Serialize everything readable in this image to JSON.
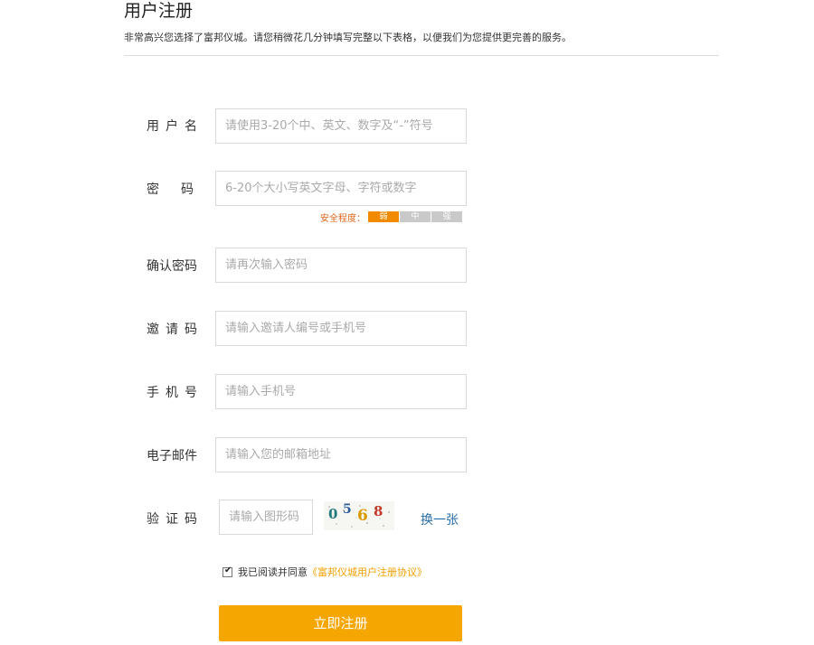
{
  "header": {
    "title": "用户注册",
    "intro": "非常高兴您选择了富邦仪城。请您稍微花几分钟填写完整以下表格，以便我们为您提供更完善的服务。"
  },
  "form": {
    "username": {
      "label": [
        "用",
        "户",
        "名"
      ],
      "placeholder": "请使用3-20个中、英文、数字及“-”符号"
    },
    "password": {
      "label": [
        "密",
        "码"
      ],
      "placeholder": "6-20个大小写英文字母、字符或数字"
    },
    "strength": {
      "label": "安全程度：",
      "levels": [
        "弱",
        "中",
        "强"
      ],
      "active": "弱"
    },
    "confirm": {
      "label": "确认密码",
      "placeholder": "请再次输入密码"
    },
    "invite": {
      "label": [
        "邀",
        "请",
        "码"
      ],
      "placeholder": "请输入邀请人编号或手机号"
    },
    "phone": {
      "label": [
        "手",
        "机",
        "号"
      ],
      "placeholder": "请输入手机号"
    },
    "email": {
      "label": "电子邮件",
      "placeholder": "请输入您的邮箱地址"
    },
    "captcha": {
      "label": [
        "验",
        "证",
        "码"
      ],
      "placeholder": "请输入图形码",
      "code": [
        "0",
        "5",
        "6",
        "8"
      ],
      "code_colors": [
        "#1d7a7a",
        "#2a5a9a",
        "#d99a00",
        "#c0392b"
      ],
      "refresh_label": "换一张"
    },
    "agreement": {
      "checked": true,
      "text": "我已阅读并同意",
      "link": "《富邦仪城用户注册协议》"
    },
    "submit_label": "立即注册"
  },
  "colors": {
    "accent": "#f5a600",
    "strength_weak": "#f08a00",
    "link": "#2a6ea6"
  }
}
